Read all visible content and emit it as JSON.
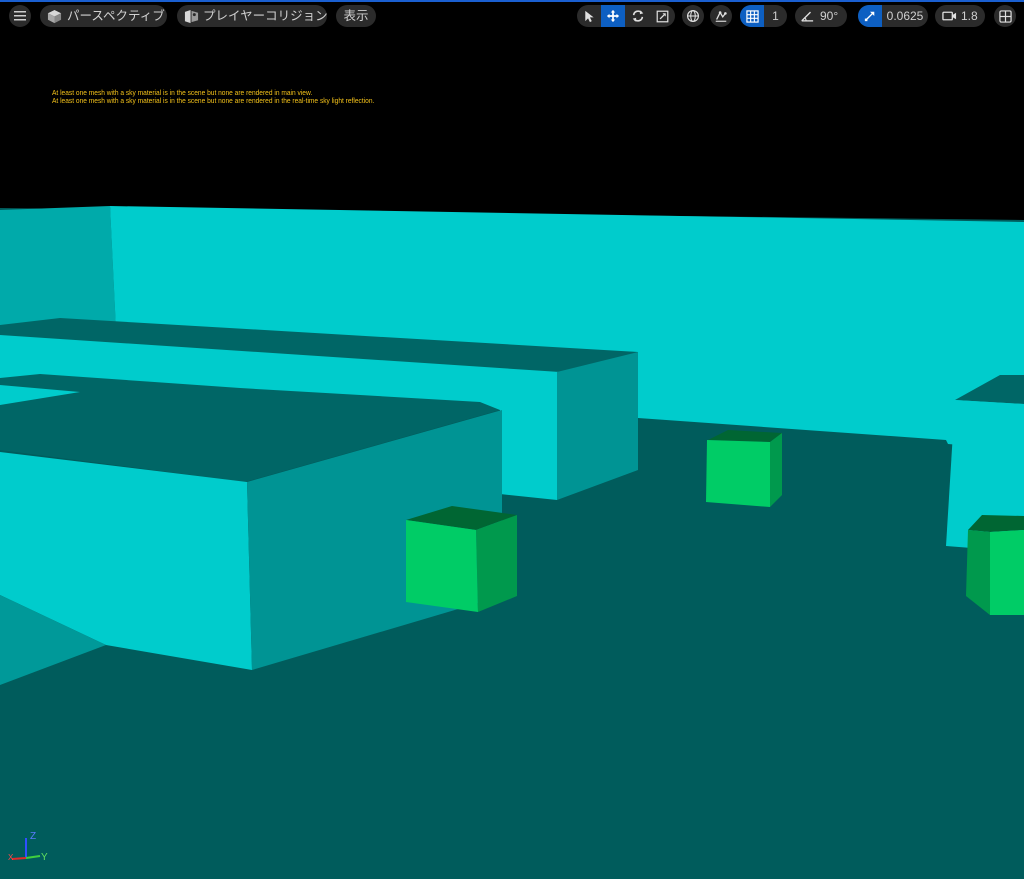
{
  "toolbar": {
    "menu_icon": "hamburger-icon",
    "perspective_label": "パースペクティブ",
    "collision_label": "プレイヤーコリジョン",
    "show_label": "表示",
    "grid_snap_value": "1",
    "rotation_snap_value": "90°",
    "scale_snap_value": "0.0625",
    "camera_speed_value": "1.8"
  },
  "messages": {
    "line1": "At least one mesh with a sky material is in the scene but none are rendered in main view.",
    "line2": "At least one mesh with a sky material is in the scene but none are rendered in the real-time sky light reflection."
  },
  "axis": {
    "z_label": "Z",
    "y_label": "Y",
    "x_label": "X"
  },
  "colors": {
    "accent": "#0d5fc2",
    "message": "#f4c21a",
    "floor": "#005c5c",
    "cyan_face": "#00cccc",
    "cyan_side": "#009494",
    "cyan_top": "#006666",
    "green_front": "#00cc66",
    "green_side": "#00994d",
    "green_top": "#006633"
  }
}
